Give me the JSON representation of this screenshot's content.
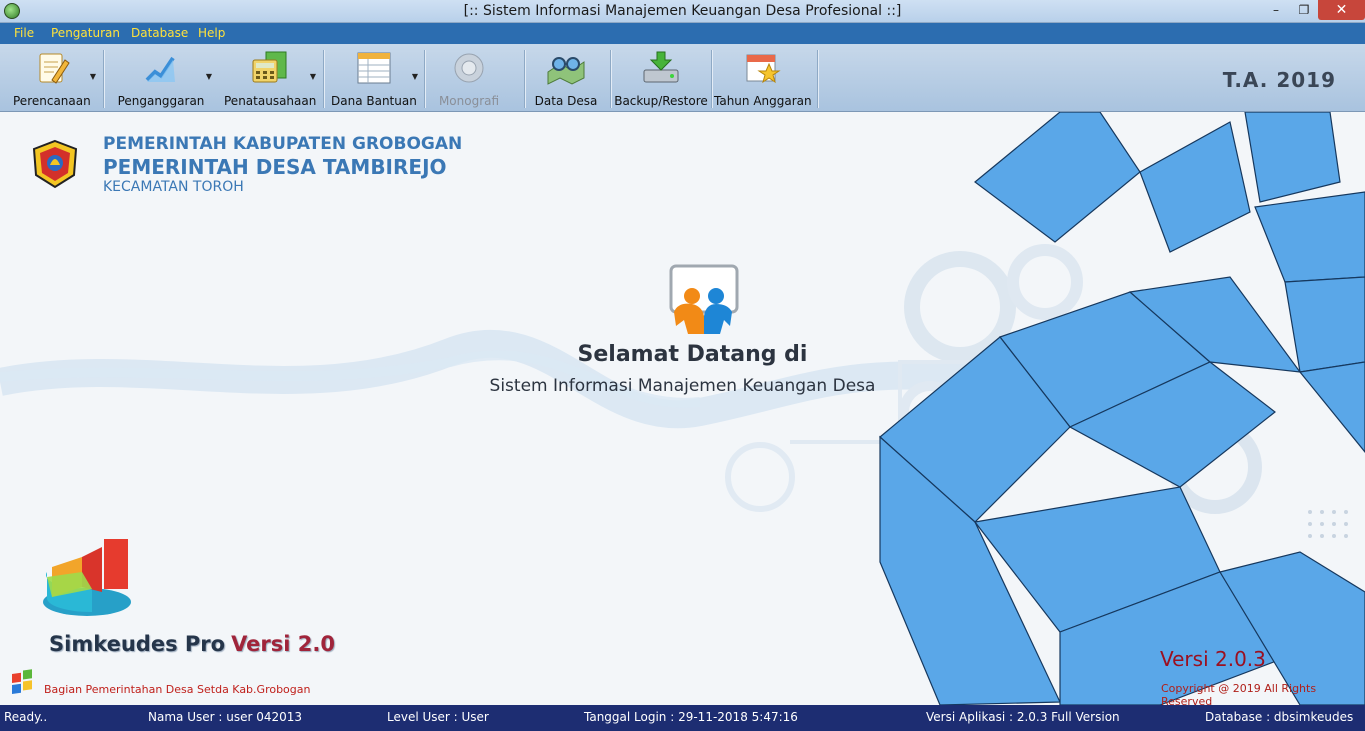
{
  "window": {
    "title": "[::  Sistem Informasi Manajemen Keuangan Desa Profesional  ::]",
    "min_glyph": "–",
    "max_glyph": "❐",
    "close_glyph": "✕"
  },
  "menu": [
    "File",
    "Pengaturan",
    "Database",
    "Help"
  ],
  "toolbar": {
    "items": [
      {
        "label": "Perencanaan",
        "icon": "planning-icon",
        "has_dropdown": true,
        "enabled": true
      },
      {
        "label": "Penganggaran",
        "icon": "budget-chart-icon",
        "has_dropdown": true,
        "enabled": true
      },
      {
        "label": "Penatausahaan",
        "icon": "calculator-icon",
        "has_dropdown": true,
        "enabled": true
      },
      {
        "label": "Dana Bantuan",
        "icon": "table-icon",
        "has_dropdown": true,
        "enabled": true
      },
      {
        "label": "Monografi",
        "icon": "camera-icon",
        "has_dropdown": false,
        "enabled": false
      },
      {
        "label": "Data Desa",
        "icon": "map-glasses-icon",
        "has_dropdown": false,
        "enabled": true
      },
      {
        "label": "Backup/Restore",
        "icon": "backup-drive-icon",
        "has_dropdown": false,
        "enabled": true
      },
      {
        "label": "Tahun Anggaran",
        "icon": "calendar-star-icon",
        "has_dropdown": false,
        "enabled": true
      }
    ],
    "dropdown_glyph": "▼",
    "fiscal_year": "T.A. 2019"
  },
  "header": {
    "line1": "PEMERINTAH KABUPATEN GROBOGAN",
    "line2": "PEMERINTAH DESA TAMBIREJO",
    "line3": "KECAMATAN TOROH",
    "emblem": "regency-emblem-icon"
  },
  "welcome": {
    "line1": "Selamat Datang di",
    "line2": "Sistem Informasi Manajemen Keuangan Desa"
  },
  "product": {
    "name": "Simkeudes Pro",
    "version": "Versi 2.0",
    "credit": "Bagian Pemerintahan Desa Setda Kab.Grobogan",
    "version_full": "Versi 2.0.3",
    "copyright": "Copyright @ 2019 All Rights Reserved"
  },
  "status": {
    "ready": "Ready..",
    "user": "Nama User :  user 042013",
    "level": "Level User :  User",
    "login": "Tanggal Login :  29-11-2018 5:47:16",
    "app_version": "Versi Aplikasi : 2.0.3  Full Version",
    "database": "Database :  dbsimkeudes"
  },
  "colors": {
    "menu_bg": "#2c6db0",
    "menu_text": "#ffe23b",
    "status_bg": "#1d2d72",
    "accent_blue": "#3b78b5"
  }
}
